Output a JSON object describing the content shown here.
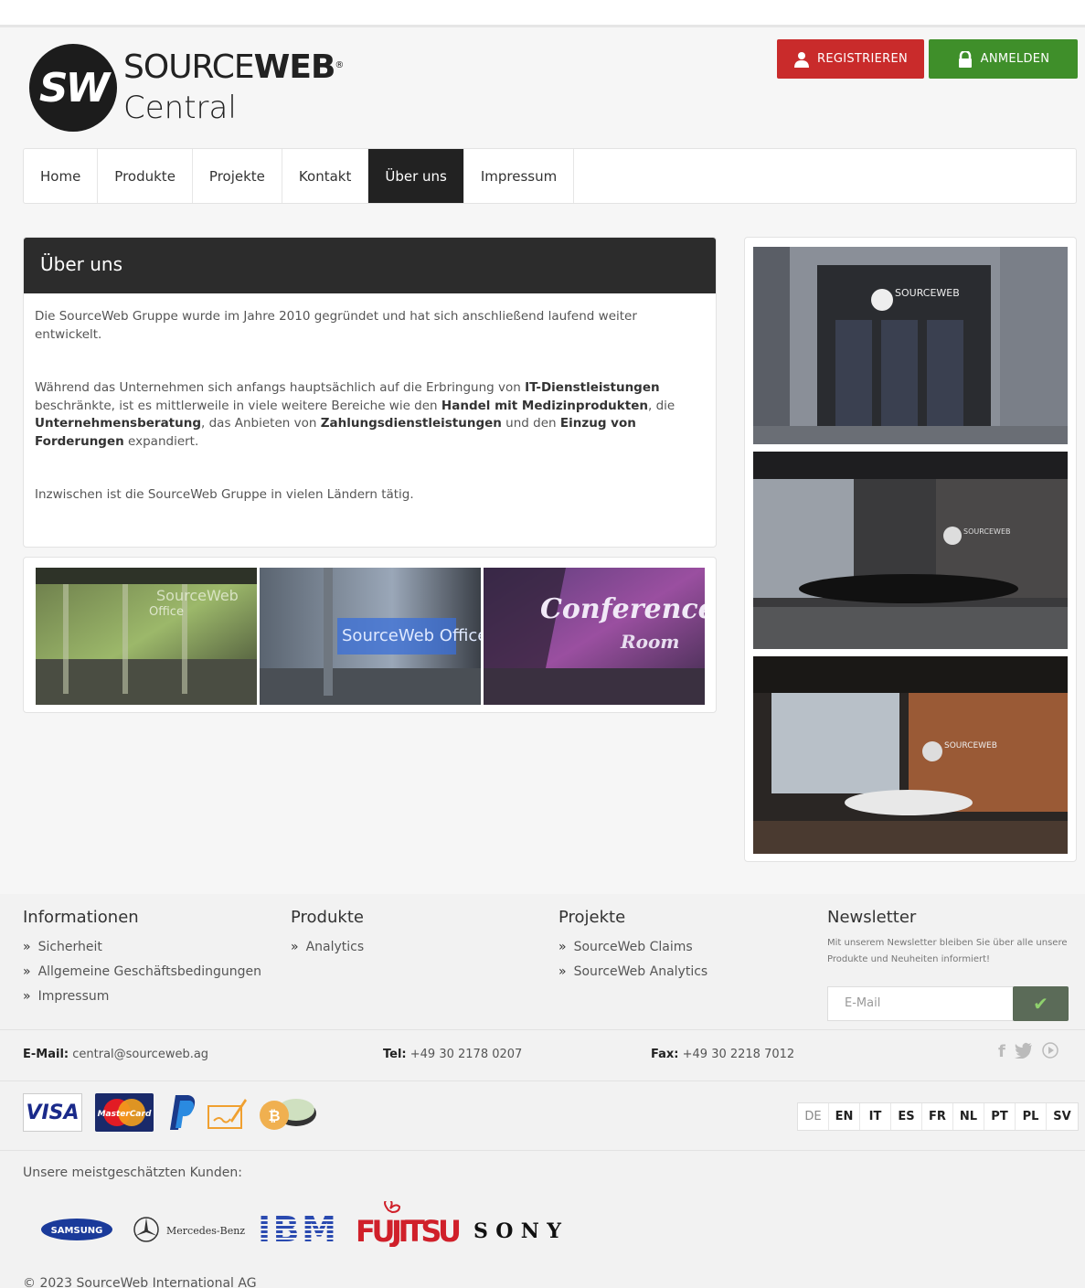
{
  "header": {
    "logo_initials": "SW",
    "logo_name_a": "SOURCE",
    "logo_name_b": "WEB",
    "logo_reg": "®",
    "logo_sub": "Central",
    "register_label": "REGISTRIEREN",
    "login_label": "ANMELDEN"
  },
  "nav": {
    "items": [
      {
        "label": "Home"
      },
      {
        "label": "Produkte"
      },
      {
        "label": "Projekte"
      },
      {
        "label": "Kontakt"
      },
      {
        "label": "Über uns"
      },
      {
        "label": "Impressum"
      }
    ],
    "active": "Über uns"
  },
  "about": {
    "title": "Über uns",
    "p1": "Die SourceWeb Gruppe wurde im Jahre 2010 gegründet und hat sich anschließend laufend weiter entwickelt.",
    "p2_a": "Während das Unternehmen sich anfangs hauptsächlich auf die Erbringung von ",
    "p2_b": "IT-Dienstleistungen",
    "p2_c": " beschränkte, ist es mittlerweile in viele weitere Bereiche wie den ",
    "p2_d": "Handel mit Medizinprodukten",
    "p2_e": ", die ",
    "p2_f": "Unternehmensberatung",
    "p2_g": ", das Anbieten von ",
    "p2_h": "Zahlungsdienstleistungen",
    "p2_i": " und den ",
    "p2_j": "Einzug von Forderungen",
    "p2_k": " expandiert.",
    "p3": "Inzwischen ist die SourceWeb Gruppe in vielen Ländern tätig."
  },
  "gallery": {
    "img1_text_a": "SourceWeb",
    "img1_text_b": "Office",
    "img2_text": "SourceWeb Office",
    "img3_text_a": "Conference",
    "img3_text_b": "Room"
  },
  "side_images": {
    "sign_text": "SOURCEWEB"
  },
  "footer": {
    "info": {
      "title": "Informationen",
      "items": [
        "Sicherheit",
        "Allgemeine Geschäftsbedingungen",
        "Impressum"
      ]
    },
    "products": {
      "title": "Produkte",
      "items": [
        "Analytics"
      ]
    },
    "projects": {
      "title": "Projekte",
      "items": [
        "SourceWeb Claims",
        "SourceWeb Analytics"
      ]
    },
    "newsletter": {
      "title": "Newsletter",
      "text": "Mit unserem Newsletter bleiben Sie über alle unsere Produkte und Neuheiten informiert!",
      "placeholder": "E-Mail",
      "submit_icon": "check-icon"
    },
    "email_label": "E-Mail:",
    "email_value": "central@sourceweb.ag",
    "tel_label": "Tel:",
    "tel_value": "+49 30 2178 0207",
    "fax_label": "Fax:",
    "fax_value": "+49 30 2218 7012",
    "social": [
      "f",
      "twitter-icon",
      "play-icon"
    ],
    "payment": {
      "visa": "VISA",
      "mastercard": "MasterCard"
    },
    "languages": [
      "DE",
      "EN",
      "IT",
      "ES",
      "FR",
      "NL",
      "PT",
      "PL",
      "SV"
    ],
    "current_language": "DE",
    "clients_title": "Unsere meistgeschätzten Kunden:",
    "clients": {
      "samsung": "SAMSUNG",
      "mercedes": "Mercedes-Benz",
      "ibm": "IBM",
      "fujitsu": "FUJITSU",
      "sony": "SONY"
    },
    "copyright": "© 2023 SourceWeb International AG"
  },
  "colors": {
    "register": "#c92b2b",
    "login": "#3f8f2a",
    "active_nav": "#222222"
  }
}
